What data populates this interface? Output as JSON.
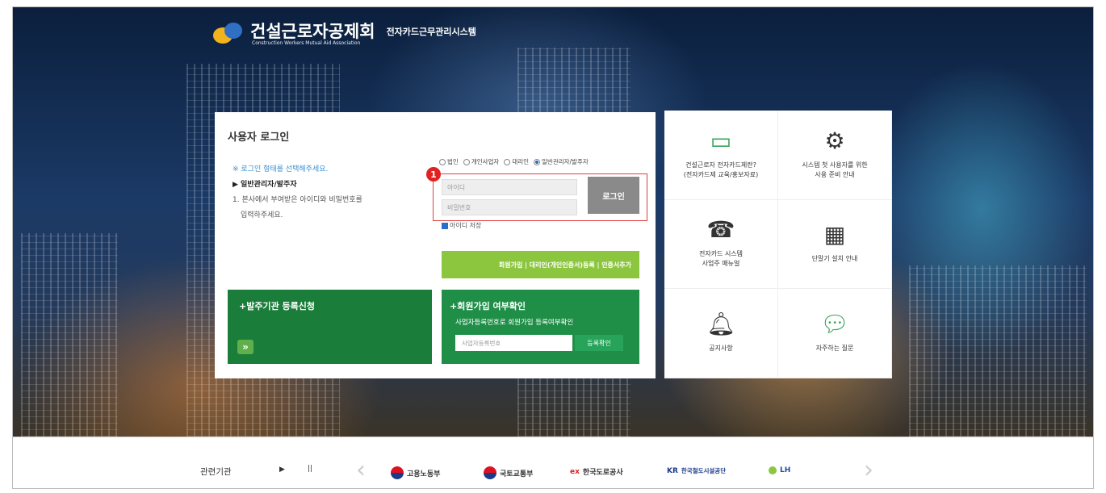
{
  "header": {
    "org_name": "건설근로자공제회",
    "org_name_en": "Construction Workers Mutual Aid Association",
    "system_name": "전자카드근무관리시스템"
  },
  "login": {
    "title": "사용자 로그인",
    "hint": "※ 로그인 형태를 선택해주세요.",
    "selected_type_heading": "▶ 일반관리자/발주자",
    "instruction_line1": "1. 본사에서 부여받은 아이디와 비밀번호를",
    "instruction_line2": "입력하주세요.",
    "radio_options": [
      {
        "label": "법인",
        "checked": false
      },
      {
        "label": "개인사업자",
        "checked": false
      },
      {
        "label": "대리인",
        "checked": false
      },
      {
        "label": "일반관리자/발주자",
        "checked": true
      }
    ],
    "id_placeholder": "아이디",
    "password_placeholder": "비밀번호",
    "login_button": "로그인",
    "callout_number": "1",
    "remember_label": "아이디 저장",
    "join_links": "회원가입 | 대리인(개인인증서)등록 | 인증서추가"
  },
  "register_panel": {
    "title": "+발주기관 등록신청",
    "arrow": "»"
  },
  "membership_check": {
    "title": "+회원가입 여부확인",
    "description": "사업자등록번호로 회원가입 등록여부확인",
    "input_placeholder": "사업자등록번호",
    "button": "등록확인"
  },
  "quick_menu": [
    {
      "icon": "card-icon",
      "glyph": "▭",
      "label": "건설근로자 전자카드제란?\n(전자카드제 교육/홍보자료)"
    },
    {
      "icon": "gear-icon",
      "glyph": "⚙",
      "label": "시스템 첫 사용자를 위한\n사용 준비 안내"
    },
    {
      "icon": "phone-person-icon",
      "glyph": "☎",
      "label": "전자카드 시스템\n사업주 매뉴얼"
    },
    {
      "icon": "terminal-icon",
      "glyph": "▦",
      "label": "단말기 설치 안내"
    },
    {
      "icon": "bell-icon",
      "glyph": "🔔︎",
      "label": "공지사항"
    },
    {
      "icon": "chat-icon",
      "glyph": "💬︎",
      "label": "자주하는 질문"
    }
  ],
  "footer": {
    "label": "관련기관",
    "play": "▶",
    "pause": "||",
    "prev": "‹",
    "next": "›",
    "orgs": [
      "고용노동부",
      "국토교통부",
      "한국도로공사",
      "한국철도시설공단",
      "LH"
    ]
  },
  "colors": {
    "green_dark": "#1b7d3a",
    "green_mid": "#1f8f48",
    "green_light": "#8cc63f",
    "highlight_red": "#e02222"
  }
}
